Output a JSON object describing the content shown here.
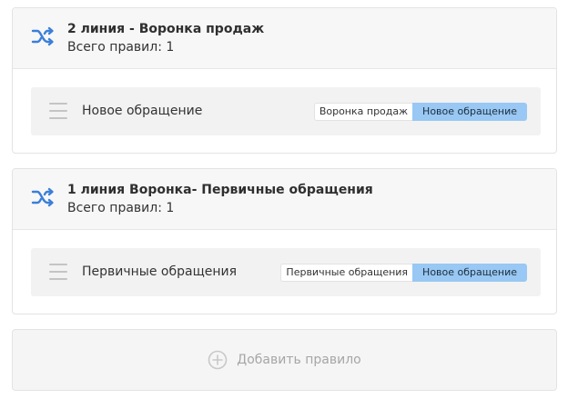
{
  "colors": {
    "accent": "#3b7fd9",
    "tag_status_bg": "#98c8f3",
    "card_header_bg": "#f7f7f7",
    "rule_row_bg": "#f2f2f2"
  },
  "groups": [
    {
      "title": "2 линия - Воронка продаж",
      "rules_count": "Всего правил: 1",
      "icon": "shuffle-icon",
      "rules": [
        {
          "name": "Новое обращение",
          "funnel": "Воронка продаж",
          "status": "Новое обращение"
        }
      ]
    },
    {
      "title": "1 линия Воронка- Первичные обращения",
      "rules_count": "Всего правил: 1",
      "icon": "shuffle-icon",
      "rules": [
        {
          "name": "Первичные обращения",
          "funnel": "Первичные обращения",
          "status": "Новое обращение"
        }
      ]
    }
  ],
  "add_rule": {
    "label": "Добавить правило",
    "icon": "plus-circle-icon"
  }
}
